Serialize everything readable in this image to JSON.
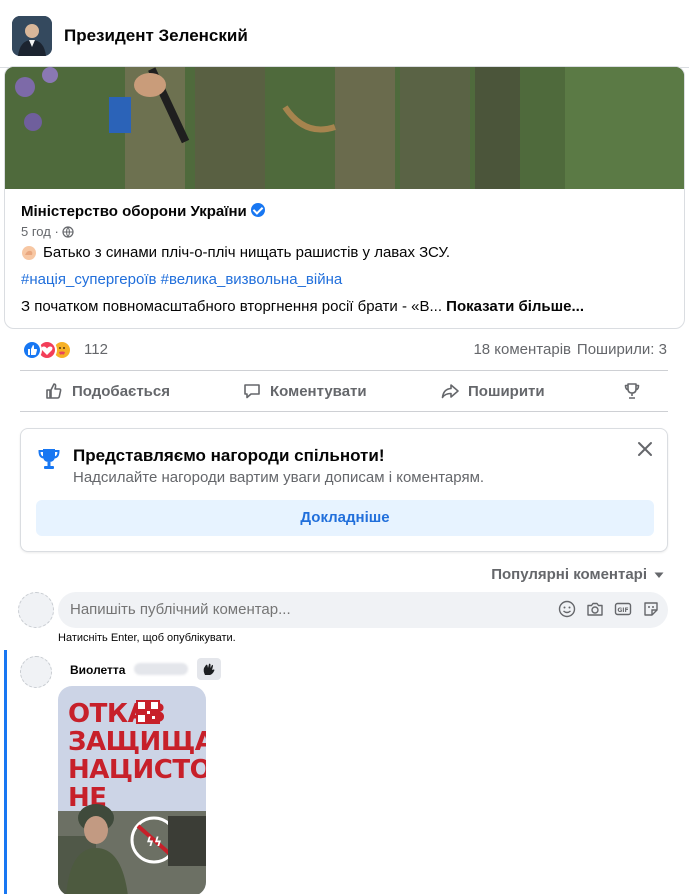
{
  "header": {
    "title": "Президент Зеленский",
    "avatar_icon": "profile-photo"
  },
  "shared_post": {
    "org_name": "Міністерство оборони України",
    "timestamp": "5 год ·",
    "text": "Батько з синами пліч-о-пліч нищать рашистів у лавах ЗСУ.",
    "hashtags": "#нація_супергероїв #велика_визвольна_війна",
    "excerpt": "З початком повномасштабного вторгнення росії брати - «В...",
    "see_more": "Показати більше..."
  },
  "reactions": {
    "count": "112",
    "comments": "18 коментарів",
    "shares": "Поширили: 3",
    "icons": [
      "like-reaction-icon",
      "love-reaction-icon",
      "care-reaction-icon"
    ]
  },
  "actions": {
    "like": "Подобається",
    "comment": "Коментувати",
    "share": "Поширити"
  },
  "awards_card": {
    "title": "Представляємо нагороди спільноти!",
    "subtitle": "Надсилайте нагороди вартим уваги дописам і коментарям.",
    "button": "Докладніше"
  },
  "comments": {
    "sort_label": "Популярні коментарі",
    "composer_placeholder": "Напишіть публічний коментар...",
    "composer_hint": "Натисніть Enter, щоб опублікувати.",
    "items": [
      {
        "author": "Виолетта",
        "image_text": [
          "ОТКАЗ",
          "ЗАЩИЩАТЬ",
          "НАЦИСТОВ",
          "НЕ ТРУСОСТЬ"
        ]
      }
    ]
  },
  "colors": {
    "accent": "#1877f2",
    "link": "#216fdb",
    "muted": "#65676b",
    "poster_red": "#c7202a"
  }
}
